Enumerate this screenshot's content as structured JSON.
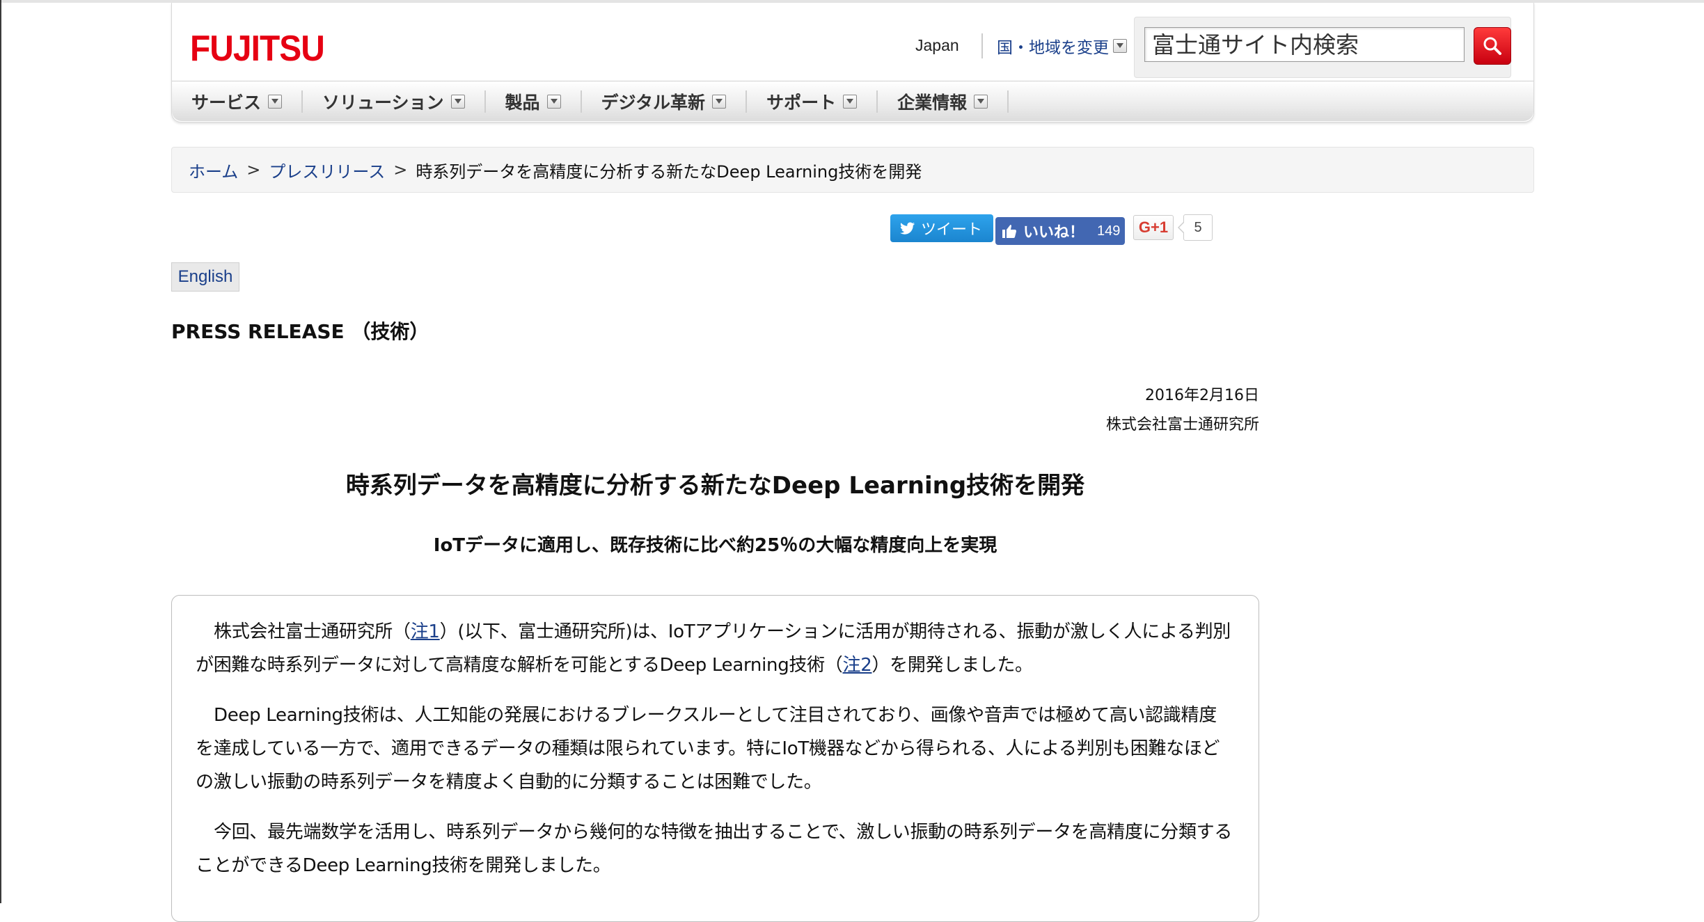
{
  "header": {
    "logo_text": "FUJITSU",
    "region_label": "Japan",
    "region_change": "国・地域を変更",
    "search_placeholder": "富士通サイト内検索"
  },
  "nav": {
    "items": [
      {
        "label": "サービス"
      },
      {
        "label": "ソリューション"
      },
      {
        "label": "製品"
      },
      {
        "label": "デジタル革新"
      },
      {
        "label": "サポート"
      },
      {
        "label": "企業情報"
      }
    ]
  },
  "breadcrumb": {
    "home": "ホーム",
    "press": "プレスリリース",
    "sep": ">",
    "current": "時系列データを高精度に分析する新たなDeep Learning技術を開発"
  },
  "social": {
    "tweet_label": "ツイート",
    "like_label": "いいね！",
    "like_count": "149",
    "gplus_label": "G+1",
    "gplus_count": "5"
  },
  "english_button": "English",
  "press_heading": "PRESS RELEASE （技術）",
  "date": "2016年2月16日",
  "company": "株式会社富士通研究所",
  "title": "時系列データを高精度に分析する新たなDeep Learning技術を開発",
  "subtitle": "IoTデータに適用し、既存技術に比べ約25％の大幅な精度向上を実現",
  "body": {
    "p1_a": "株式会社富士通研究所（",
    "p1_note1": "注1",
    "p1_b": "）(以下、富士通研究所)は、IoTアプリケーションに活用が期待される、振動が激しく人による判別が困難な時系列データに対して高精度な解析を可能とするDeep Learning技術（",
    "p1_note2": "注2",
    "p1_c": "）を開発しました。",
    "p2": "Deep Learning技術は、人工知能の発展におけるブレークスルーとして注目されており、画像や音声では極めて高い認識精度を達成している一方で、適用できるデータの種類は限られています。特にIoT機器などから得られる、人による判別も困難なほどの激しい振動の時系列データを精度よく自動的に分類することは困難でした。",
    "p3": "今回、最先端数学を活用し、時系列データから幾何的な特徴を抽出することで、激しい振動の時系列データを高精度に分類することができるDeep Learning技術を開発しました。"
  }
}
